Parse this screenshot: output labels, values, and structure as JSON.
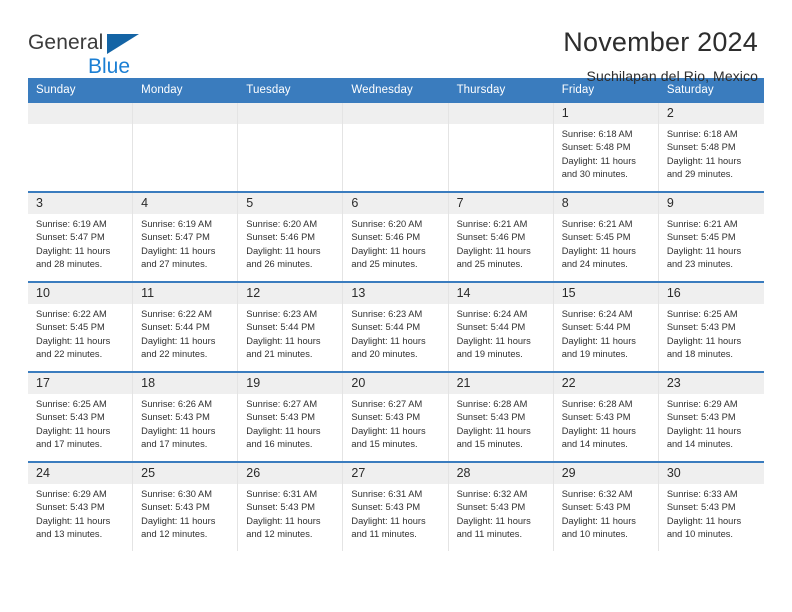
{
  "brand": {
    "name_part1": "General",
    "name_part2": "Blue",
    "logo_icon": "blue-triangle-logo"
  },
  "header": {
    "title": "November 2024",
    "subtitle": "Suchilapan del Rio, Mexico"
  },
  "colors": {
    "header_blue": "#3a7cbe",
    "brand_blue": "#1b7fd4",
    "logo_blue": "#1464a5",
    "day_band": "#efefef"
  },
  "weekdays": [
    "Sunday",
    "Monday",
    "Tuesday",
    "Wednesday",
    "Thursday",
    "Friday",
    "Saturday"
  ],
  "weeks": [
    [
      {
        "day": "",
        "empty": true
      },
      {
        "day": "",
        "empty": true
      },
      {
        "day": "",
        "empty": true
      },
      {
        "day": "",
        "empty": true
      },
      {
        "day": "",
        "empty": true
      },
      {
        "day": "1",
        "sunrise": "Sunrise: 6:18 AM",
        "sunset": "Sunset: 5:48 PM",
        "daylight": "Daylight: 11 hours and 30 minutes."
      },
      {
        "day": "2",
        "sunrise": "Sunrise: 6:18 AM",
        "sunset": "Sunset: 5:48 PM",
        "daylight": "Daylight: 11 hours and 29 minutes."
      }
    ],
    [
      {
        "day": "3",
        "sunrise": "Sunrise: 6:19 AM",
        "sunset": "Sunset: 5:47 PM",
        "daylight": "Daylight: 11 hours and 28 minutes."
      },
      {
        "day": "4",
        "sunrise": "Sunrise: 6:19 AM",
        "sunset": "Sunset: 5:47 PM",
        "daylight": "Daylight: 11 hours and 27 minutes."
      },
      {
        "day": "5",
        "sunrise": "Sunrise: 6:20 AM",
        "sunset": "Sunset: 5:46 PM",
        "daylight": "Daylight: 11 hours and 26 minutes."
      },
      {
        "day": "6",
        "sunrise": "Sunrise: 6:20 AM",
        "sunset": "Sunset: 5:46 PM",
        "daylight": "Daylight: 11 hours and 25 minutes."
      },
      {
        "day": "7",
        "sunrise": "Sunrise: 6:21 AM",
        "sunset": "Sunset: 5:46 PM",
        "daylight": "Daylight: 11 hours and 25 minutes."
      },
      {
        "day": "8",
        "sunrise": "Sunrise: 6:21 AM",
        "sunset": "Sunset: 5:45 PM",
        "daylight": "Daylight: 11 hours and 24 minutes."
      },
      {
        "day": "9",
        "sunrise": "Sunrise: 6:21 AM",
        "sunset": "Sunset: 5:45 PM",
        "daylight": "Daylight: 11 hours and 23 minutes."
      }
    ],
    [
      {
        "day": "10",
        "sunrise": "Sunrise: 6:22 AM",
        "sunset": "Sunset: 5:45 PM",
        "daylight": "Daylight: 11 hours and 22 minutes."
      },
      {
        "day": "11",
        "sunrise": "Sunrise: 6:22 AM",
        "sunset": "Sunset: 5:44 PM",
        "daylight": "Daylight: 11 hours and 22 minutes."
      },
      {
        "day": "12",
        "sunrise": "Sunrise: 6:23 AM",
        "sunset": "Sunset: 5:44 PM",
        "daylight": "Daylight: 11 hours and 21 minutes."
      },
      {
        "day": "13",
        "sunrise": "Sunrise: 6:23 AM",
        "sunset": "Sunset: 5:44 PM",
        "daylight": "Daylight: 11 hours and 20 minutes."
      },
      {
        "day": "14",
        "sunrise": "Sunrise: 6:24 AM",
        "sunset": "Sunset: 5:44 PM",
        "daylight": "Daylight: 11 hours and 19 minutes."
      },
      {
        "day": "15",
        "sunrise": "Sunrise: 6:24 AM",
        "sunset": "Sunset: 5:44 PM",
        "daylight": "Daylight: 11 hours and 19 minutes."
      },
      {
        "day": "16",
        "sunrise": "Sunrise: 6:25 AM",
        "sunset": "Sunset: 5:43 PM",
        "daylight": "Daylight: 11 hours and 18 minutes."
      }
    ],
    [
      {
        "day": "17",
        "sunrise": "Sunrise: 6:25 AM",
        "sunset": "Sunset: 5:43 PM",
        "daylight": "Daylight: 11 hours and 17 minutes."
      },
      {
        "day": "18",
        "sunrise": "Sunrise: 6:26 AM",
        "sunset": "Sunset: 5:43 PM",
        "daylight": "Daylight: 11 hours and 17 minutes."
      },
      {
        "day": "19",
        "sunrise": "Sunrise: 6:27 AM",
        "sunset": "Sunset: 5:43 PM",
        "daylight": "Daylight: 11 hours and 16 minutes."
      },
      {
        "day": "20",
        "sunrise": "Sunrise: 6:27 AM",
        "sunset": "Sunset: 5:43 PM",
        "daylight": "Daylight: 11 hours and 15 minutes."
      },
      {
        "day": "21",
        "sunrise": "Sunrise: 6:28 AM",
        "sunset": "Sunset: 5:43 PM",
        "daylight": "Daylight: 11 hours and 15 minutes."
      },
      {
        "day": "22",
        "sunrise": "Sunrise: 6:28 AM",
        "sunset": "Sunset: 5:43 PM",
        "daylight": "Daylight: 11 hours and 14 minutes."
      },
      {
        "day": "23",
        "sunrise": "Sunrise: 6:29 AM",
        "sunset": "Sunset: 5:43 PM",
        "daylight": "Daylight: 11 hours and 14 minutes."
      }
    ],
    [
      {
        "day": "24",
        "sunrise": "Sunrise: 6:29 AM",
        "sunset": "Sunset: 5:43 PM",
        "daylight": "Daylight: 11 hours and 13 minutes."
      },
      {
        "day": "25",
        "sunrise": "Sunrise: 6:30 AM",
        "sunset": "Sunset: 5:43 PM",
        "daylight": "Daylight: 11 hours and 12 minutes."
      },
      {
        "day": "26",
        "sunrise": "Sunrise: 6:31 AM",
        "sunset": "Sunset: 5:43 PM",
        "daylight": "Daylight: 11 hours and 12 minutes."
      },
      {
        "day": "27",
        "sunrise": "Sunrise: 6:31 AM",
        "sunset": "Sunset: 5:43 PM",
        "daylight": "Daylight: 11 hours and 11 minutes."
      },
      {
        "day": "28",
        "sunrise": "Sunrise: 6:32 AM",
        "sunset": "Sunset: 5:43 PM",
        "daylight": "Daylight: 11 hours and 11 minutes."
      },
      {
        "day": "29",
        "sunrise": "Sunrise: 6:32 AM",
        "sunset": "Sunset: 5:43 PM",
        "daylight": "Daylight: 11 hours and 10 minutes."
      },
      {
        "day": "30",
        "sunrise": "Sunrise: 6:33 AM",
        "sunset": "Sunset: 5:43 PM",
        "daylight": "Daylight: 11 hours and 10 minutes."
      }
    ]
  ]
}
